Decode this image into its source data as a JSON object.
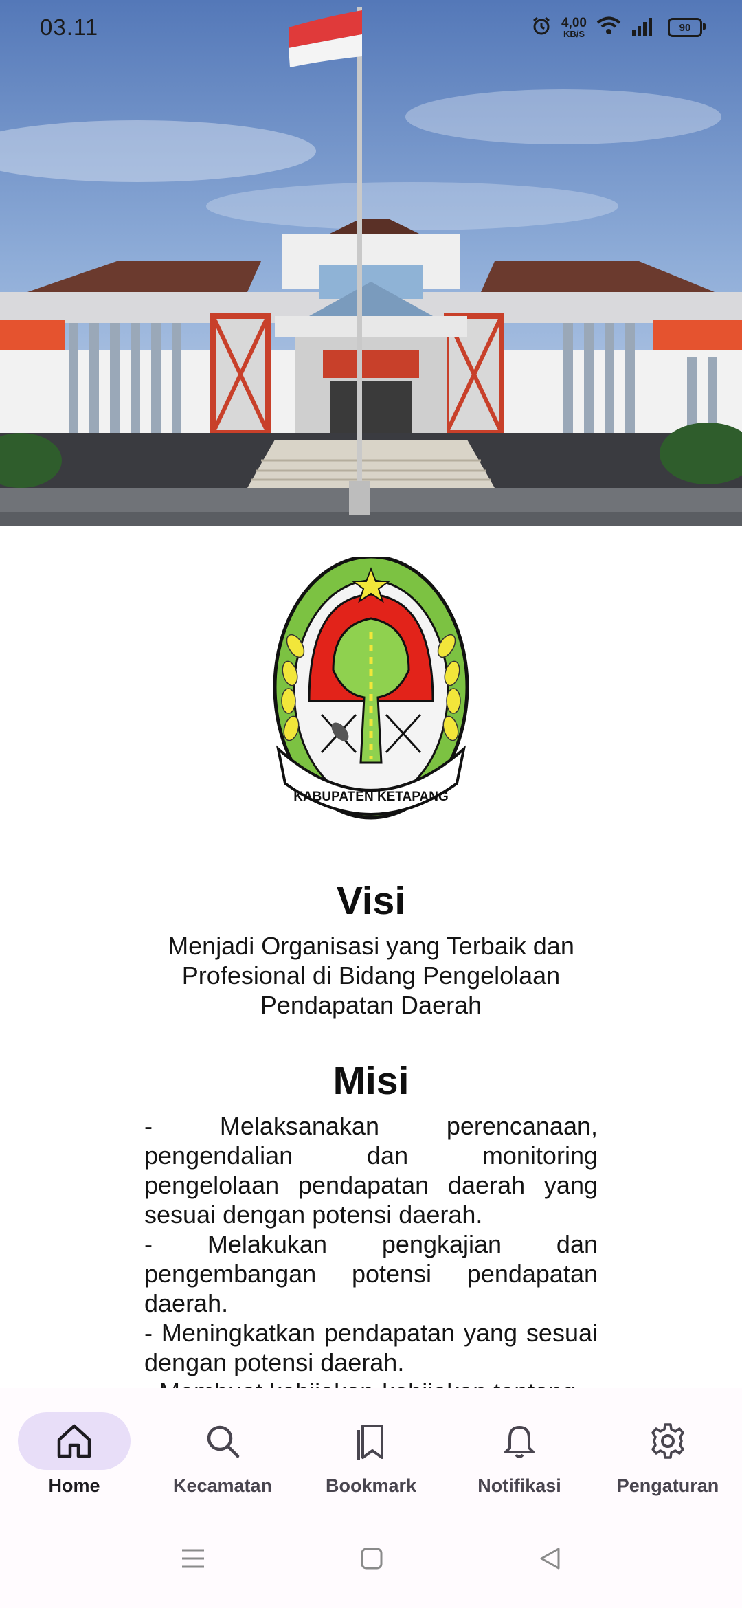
{
  "status_bar": {
    "time": "03.11",
    "net_speed_value": "4,00",
    "net_speed_unit": "KB/S",
    "battery": "90",
    "icons": [
      "alarm-icon",
      "wifi-icon",
      "signal-icon",
      "battery-icon"
    ]
  },
  "hero": {
    "image": "regency-office-building-photo"
  },
  "logo": {
    "banner_text": "KABUPATEN KETAPANG"
  },
  "visi": {
    "title": "Visi",
    "text": "Menjadi Organisasi yang Terbaik dan Profesional di Bidang Pengelolaan Pendapatan Daerah"
  },
  "misi": {
    "title": "Misi",
    "items": [
      "- Melaksanakan perencanaan, pengendalian dan monitoring pengelolaan pendapatan daerah yang sesuai dengan potensi daerah.",
      "- Melakukan pengkajian dan pengembangan potensi pendapatan daerah.",
      "- Meningkatkan pendapatan yang sesuai dengan potensi daerah.",
      "- Membuat kebijakan-kebijakan tentang"
    ]
  },
  "bottom_nav": {
    "items": [
      {
        "label": "Home",
        "icon": "home-icon",
        "active": true
      },
      {
        "label": "Kecamatan",
        "icon": "search-icon",
        "active": false
      },
      {
        "label": "Bookmark",
        "icon": "bookmark-icon",
        "active": false
      },
      {
        "label": "Notifikasi",
        "icon": "bell-icon",
        "active": false
      },
      {
        "label": "Pengaturan",
        "icon": "gear-icon",
        "active": false
      }
    ]
  },
  "system_nav": {
    "icons": [
      "menu-icon",
      "home-square-icon",
      "back-icon"
    ]
  },
  "colors": {
    "nav_active_bg": "#e8def8",
    "sky": "#6e93c9",
    "logo_green": "#7cc242",
    "logo_red": "#e2231a"
  }
}
